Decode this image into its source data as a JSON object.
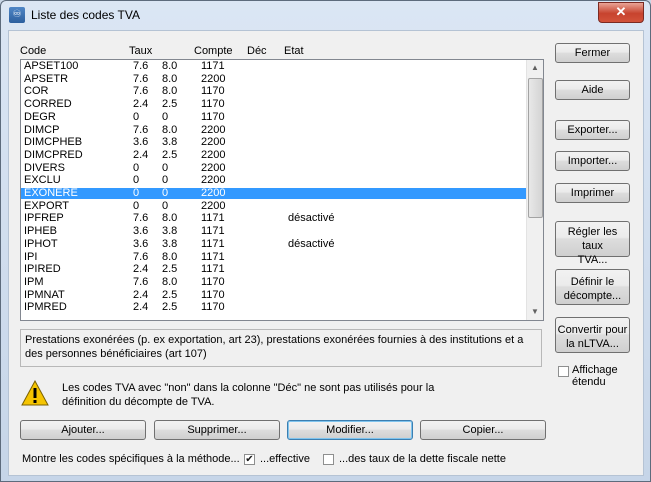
{
  "window": {
    "title": "Liste des codes TVA",
    "close_glyph": "✕"
  },
  "columns": {
    "code": "Code",
    "taux": "Taux",
    "compte": "Compte",
    "dec": "Déc",
    "etat": "Etat"
  },
  "rows": [
    {
      "code": "APSET100",
      "t1": "7.6",
      "t2": "8.0",
      "compte": "1171",
      "etat": ""
    },
    {
      "code": "APSETR",
      "t1": "7.6",
      "t2": "8.0",
      "compte": "2200",
      "etat": ""
    },
    {
      "code": "COR",
      "t1": "7.6",
      "t2": "8.0",
      "compte": "1170",
      "etat": ""
    },
    {
      "code": "CORRED",
      "t1": "2.4",
      "t2": "2.5",
      "compte": "1170",
      "etat": ""
    },
    {
      "code": "DEGR",
      "t1": "0",
      "t2": "0",
      "compte": "1170",
      "etat": ""
    },
    {
      "code": "DIMCP",
      "t1": "7.6",
      "t2": "8.0",
      "compte": "2200",
      "etat": ""
    },
    {
      "code": "DIMCPHEB",
      "t1": "3.6",
      "t2": "3.8",
      "compte": "2200",
      "etat": ""
    },
    {
      "code": "DIMCPRED",
      "t1": "2.4",
      "t2": "2.5",
      "compte": "2200",
      "etat": ""
    },
    {
      "code": "DIVERS",
      "t1": "0",
      "t2": "0",
      "compte": "2200",
      "etat": ""
    },
    {
      "code": "EXCLU",
      "t1": "0",
      "t2": "0",
      "compte": "2200",
      "etat": ""
    },
    {
      "code": "EXONERE",
      "t1": "0",
      "t2": "0",
      "compte": "2200",
      "etat": "",
      "selected": true
    },
    {
      "code": "EXPORT",
      "t1": "0",
      "t2": "0",
      "compte": "2200",
      "etat": ""
    },
    {
      "code": "IPFREP",
      "t1": "7.6",
      "t2": "8.0",
      "compte": "1171",
      "etat": "désactivé"
    },
    {
      "code": "IPHEB",
      "t1": "3.6",
      "t2": "3.8",
      "compte": "1171",
      "etat": ""
    },
    {
      "code": "IPHOT",
      "t1": "3.6",
      "t2": "3.8",
      "compte": "1171",
      "etat": "désactivé"
    },
    {
      "code": "IPI",
      "t1": "7.6",
      "t2": "8.0",
      "compte": "1171",
      "etat": ""
    },
    {
      "code": "IPIRED",
      "t1": "2.4",
      "t2": "2.5",
      "compte": "1171",
      "etat": ""
    },
    {
      "code": "IPM",
      "t1": "7.6",
      "t2": "8.0",
      "compte": "1170",
      "etat": ""
    },
    {
      "code": "IPMNAT",
      "t1": "2.4",
      "t2": "2.5",
      "compte": "1170",
      "etat": ""
    },
    {
      "code": "IPMRED",
      "t1": "2.4",
      "t2": "2.5",
      "compte": "1170",
      "etat": ""
    }
  ],
  "description": "Prestations exonérées (p. ex exportation, art 23), prestations exonérées fournies à des institutions et a des personnes bénéficiaires (art 107)",
  "warning": "Les codes TVA avec \"non\" dans la colonne \"Déc\" ne sont pas utilisés pour la définition du décompte de TVA.",
  "side_buttons": {
    "fermer": "Fermer",
    "aide": "Aide",
    "exporter": "Exporter...",
    "importer": "Importer...",
    "imprimer": "Imprimer",
    "regler_1": "Régler les taux",
    "regler_2": "TVA...",
    "definir_1": "Définir le",
    "definir_2": "décompte...",
    "convertir_1": "Convertir pour",
    "convertir_2": "la nLTVA..."
  },
  "affichage": {
    "label_1": "Affichage",
    "label_2": "étendu",
    "checked": false
  },
  "bottom_buttons": {
    "ajouter": "Ajouter...",
    "supprimer": "Supprimer...",
    "modifier": "Modifier...",
    "copier": "Copier..."
  },
  "filter": {
    "label": "Montre les codes spécifiques à  la méthode...",
    "effective_label": "...effective",
    "effective_checked": true,
    "taux_label": "...des taux de la dette fiscale nette",
    "taux_checked": false
  }
}
